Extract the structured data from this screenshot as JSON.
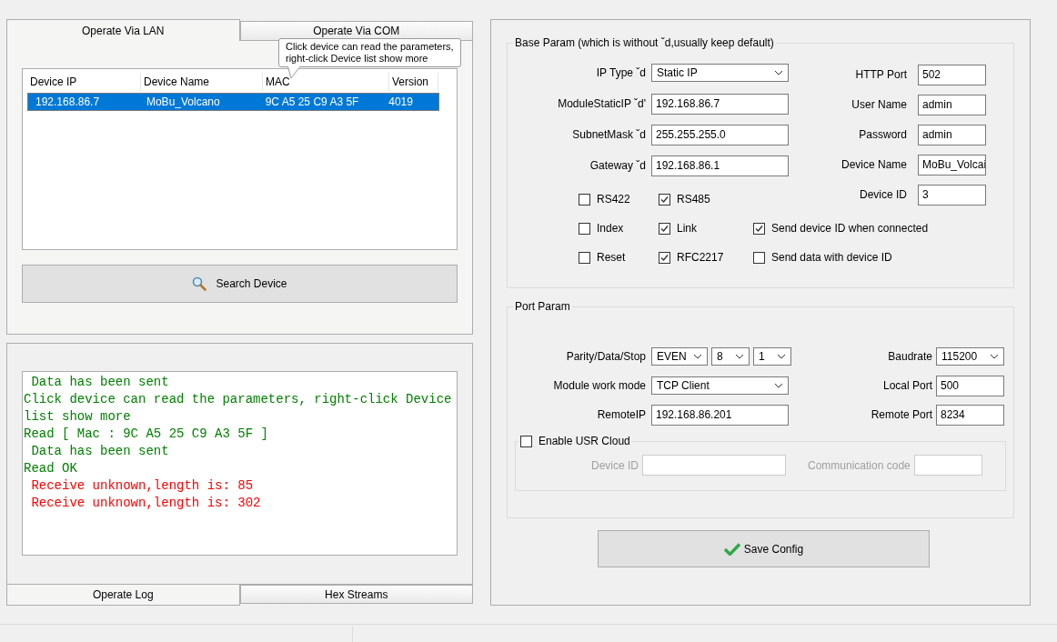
{
  "lan_panel": {
    "tabs": [
      {
        "label": "Operate Via LAN",
        "selected": true
      },
      {
        "label": "Operate Via COM",
        "selected": false
      }
    ],
    "tooltip": {
      "lines": [
        "Click device can read the parameters,",
        "right-click Device list show more"
      ]
    },
    "device_table": {
      "columns": [
        "Device IP",
        "Device Name",
        "MAC",
        "Version"
      ],
      "rows": [
        {
          "cells": [
            "192.168.86.7",
            "MoBu_Volcano",
            "9C A5 25 C9 A3 5F",
            "4019"
          ],
          "selected": true
        }
      ]
    },
    "search_button": "Search Device"
  },
  "log_panel": {
    "lines": [
      {
        "text": " Data has been sent",
        "kind": "info"
      },
      {
        "text": "Click device can read the parameters, right-click Device list show more",
        "kind": "info"
      },
      {
        "text": "Read [ Mac : 9C A5 25 C9 A3 5F ]",
        "kind": "info"
      },
      {
        "text": " Data has been sent",
        "kind": "info"
      },
      {
        "text": "Read OK",
        "kind": "info"
      },
      {
        "text": " Receive unknown,length is: 85",
        "kind": "error"
      },
      {
        "text": " Receive unknown,length is: 302",
        "kind": "error"
      }
    ],
    "tabs": [
      {
        "label": "Operate Log",
        "selected": true
      },
      {
        "label": "Hex Streams",
        "selected": false
      }
    ]
  },
  "base_param": {
    "title": "Base Param (which is without ˇd,usually keep default)",
    "left_fields": [
      {
        "label": "IP Type ˇd",
        "value": "Static IP",
        "kind": "select"
      },
      {
        "label": "ModuleStaticIP ˇd'",
        "value": "192.168.86.7",
        "kind": "input"
      },
      {
        "label": "SubnetMask ˇd",
        "value": "255.255.255.0",
        "kind": "input"
      },
      {
        "label": "Gateway ˇd",
        "value": "192.168.86.1",
        "kind": "input"
      }
    ],
    "right_fields": [
      {
        "label": "HTTP Port",
        "value": "502"
      },
      {
        "label": "User Name",
        "value": "admin"
      },
      {
        "label": "Password",
        "value": "admin"
      },
      {
        "label": "Device Name",
        "value": "MoBu_Volcai"
      },
      {
        "label": "Device ID",
        "value": "3"
      }
    ],
    "checkbox_rows": [
      [
        {
          "label": "RS422",
          "checked": false
        },
        {
          "label": "RS485",
          "checked": true
        }
      ],
      [
        {
          "label": "Index",
          "checked": false
        },
        {
          "label": "Link",
          "checked": true
        },
        {
          "label": "Send device ID when connected",
          "checked": true
        }
      ],
      [
        {
          "label": "Reset",
          "checked": false
        },
        {
          "label": "RFC2217",
          "checked": true
        },
        {
          "label": "Send data with device ID",
          "checked": false
        }
      ]
    ]
  },
  "port_param": {
    "title": "Port Param",
    "parity_data_stop": {
      "label": "Parity/Data/Stop",
      "values": [
        "EVEN",
        "8",
        "1"
      ]
    },
    "work_mode": {
      "label": "Module work mode",
      "value": "TCP Client"
    },
    "remote_ip": {
      "label": "RemoteIP",
      "value": "192.168.86.201"
    },
    "right_fields": [
      {
        "label": "Baudrate",
        "value": "115200",
        "kind": "select"
      },
      {
        "label": "Local Port",
        "value": "500",
        "kind": "input"
      },
      {
        "label": "Remote Port",
        "value": "8234",
        "kind": "input"
      }
    ],
    "usr_cloud": {
      "label": "Enable USR Cloud",
      "checked": false,
      "disabled": true,
      "fields": [
        {
          "label": "Device ID"
        },
        {
          "label": "Communication code"
        }
      ]
    }
  },
  "save_button": "Save Config"
}
